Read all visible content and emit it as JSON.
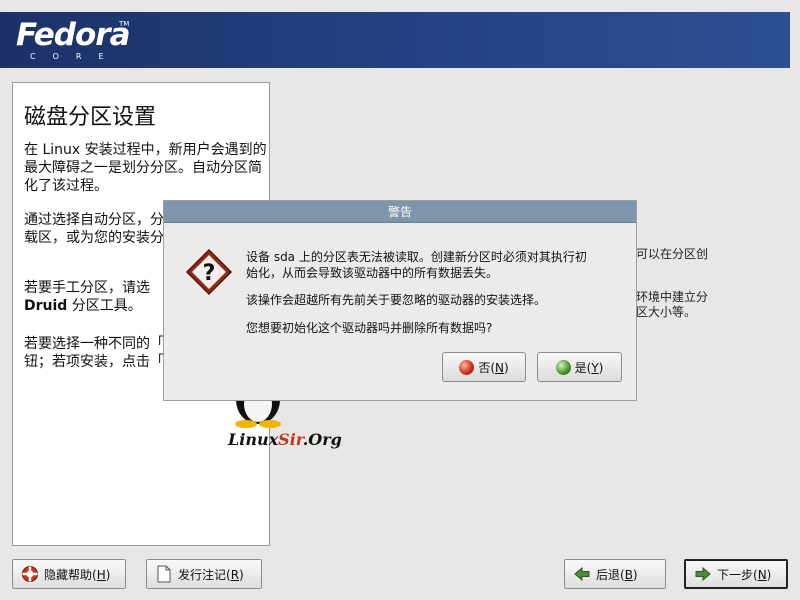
{
  "banner": {
    "logo_word": "Fedora",
    "logo_sub": "CORE",
    "logo_tm": "TM"
  },
  "help": {
    "title": "磁盘分区设置",
    "para1": "在 Linux 安装过程中，新用户会遇到的最大障碍之一是划分分区。自动分区简化了该过程。",
    "para2": "通过选择自动分区，分区工具来分配挂载区，或为您的安装分",
    "para3_a": "若要手工分区，请选",
    "para3_b": "Druid",
    "para3_c": " 分区工具。",
    "para4": "若要选择一种不同的「上一步」按钮；若项安装，点击「下一"
  },
  "background": {
    "line1": "可以在分区创",
    "line2": "环境中建立分",
    "line3": "区大小等。"
  },
  "dialog": {
    "title": "警告",
    "msg1": "设备 sda 上的分区表无法被读取。创建新分区时必须对其执行初",
    "msg2": "始化，从而会导致该驱动器中的所有数据丢失。",
    "msg3": "该操作会超越所有先前关于要忽略的驱动器的安装选择。",
    "msg4": "您想要初始化这个驱动器吗并删除所有数据吗?",
    "no_label": "否(",
    "no_key": "N",
    "no_close": ")",
    "yes_label": "是(",
    "yes_key": "Y",
    "yes_close": ")"
  },
  "watermark": {
    "text_a": "Linux",
    "text_b": "Sir",
    "text_c": ".Org"
  },
  "bottom": {
    "hide_help_label": "隐藏帮助(",
    "hide_help_key": "H",
    "release_notes_label": "发行注记(",
    "release_notes_key": "R",
    "back_label": "后退(",
    "back_key": "B",
    "next_label": "下一步(",
    "next_key": "N",
    "close": ")"
  },
  "colors": {
    "banner": "#23407f",
    "dialog_title": "#7f95ab"
  }
}
